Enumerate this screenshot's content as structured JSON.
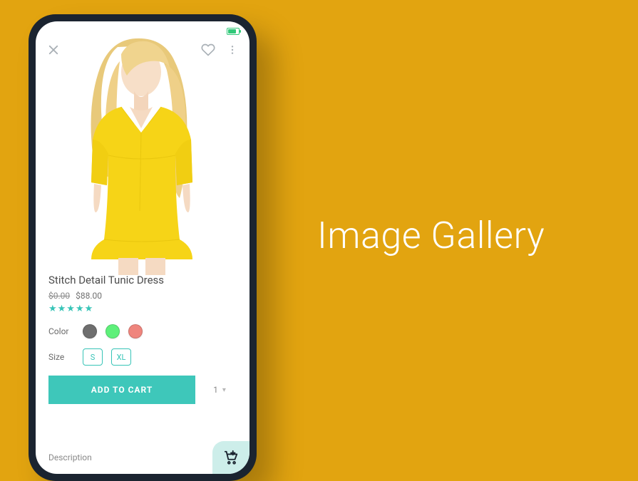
{
  "page": {
    "heading": "Image Gallery"
  },
  "status": {
    "battery_icon": "battery-icon"
  },
  "topbar": {
    "close_icon": "close-icon",
    "heart_icon": "heart-icon",
    "more_icon": "more-vertical-icon"
  },
  "product": {
    "title": "Stitch Detail Tunic Dress",
    "old_price": "$0.00",
    "price": "$88.00",
    "rating_stars": "★★★★★",
    "color_label": "Color",
    "colors": [
      "grey",
      "green",
      "coral"
    ],
    "size_label": "Size",
    "sizes": [
      "S",
      "XL"
    ],
    "add_label": "ADD TO CART",
    "qty": "1",
    "description_label": "Description"
  }
}
